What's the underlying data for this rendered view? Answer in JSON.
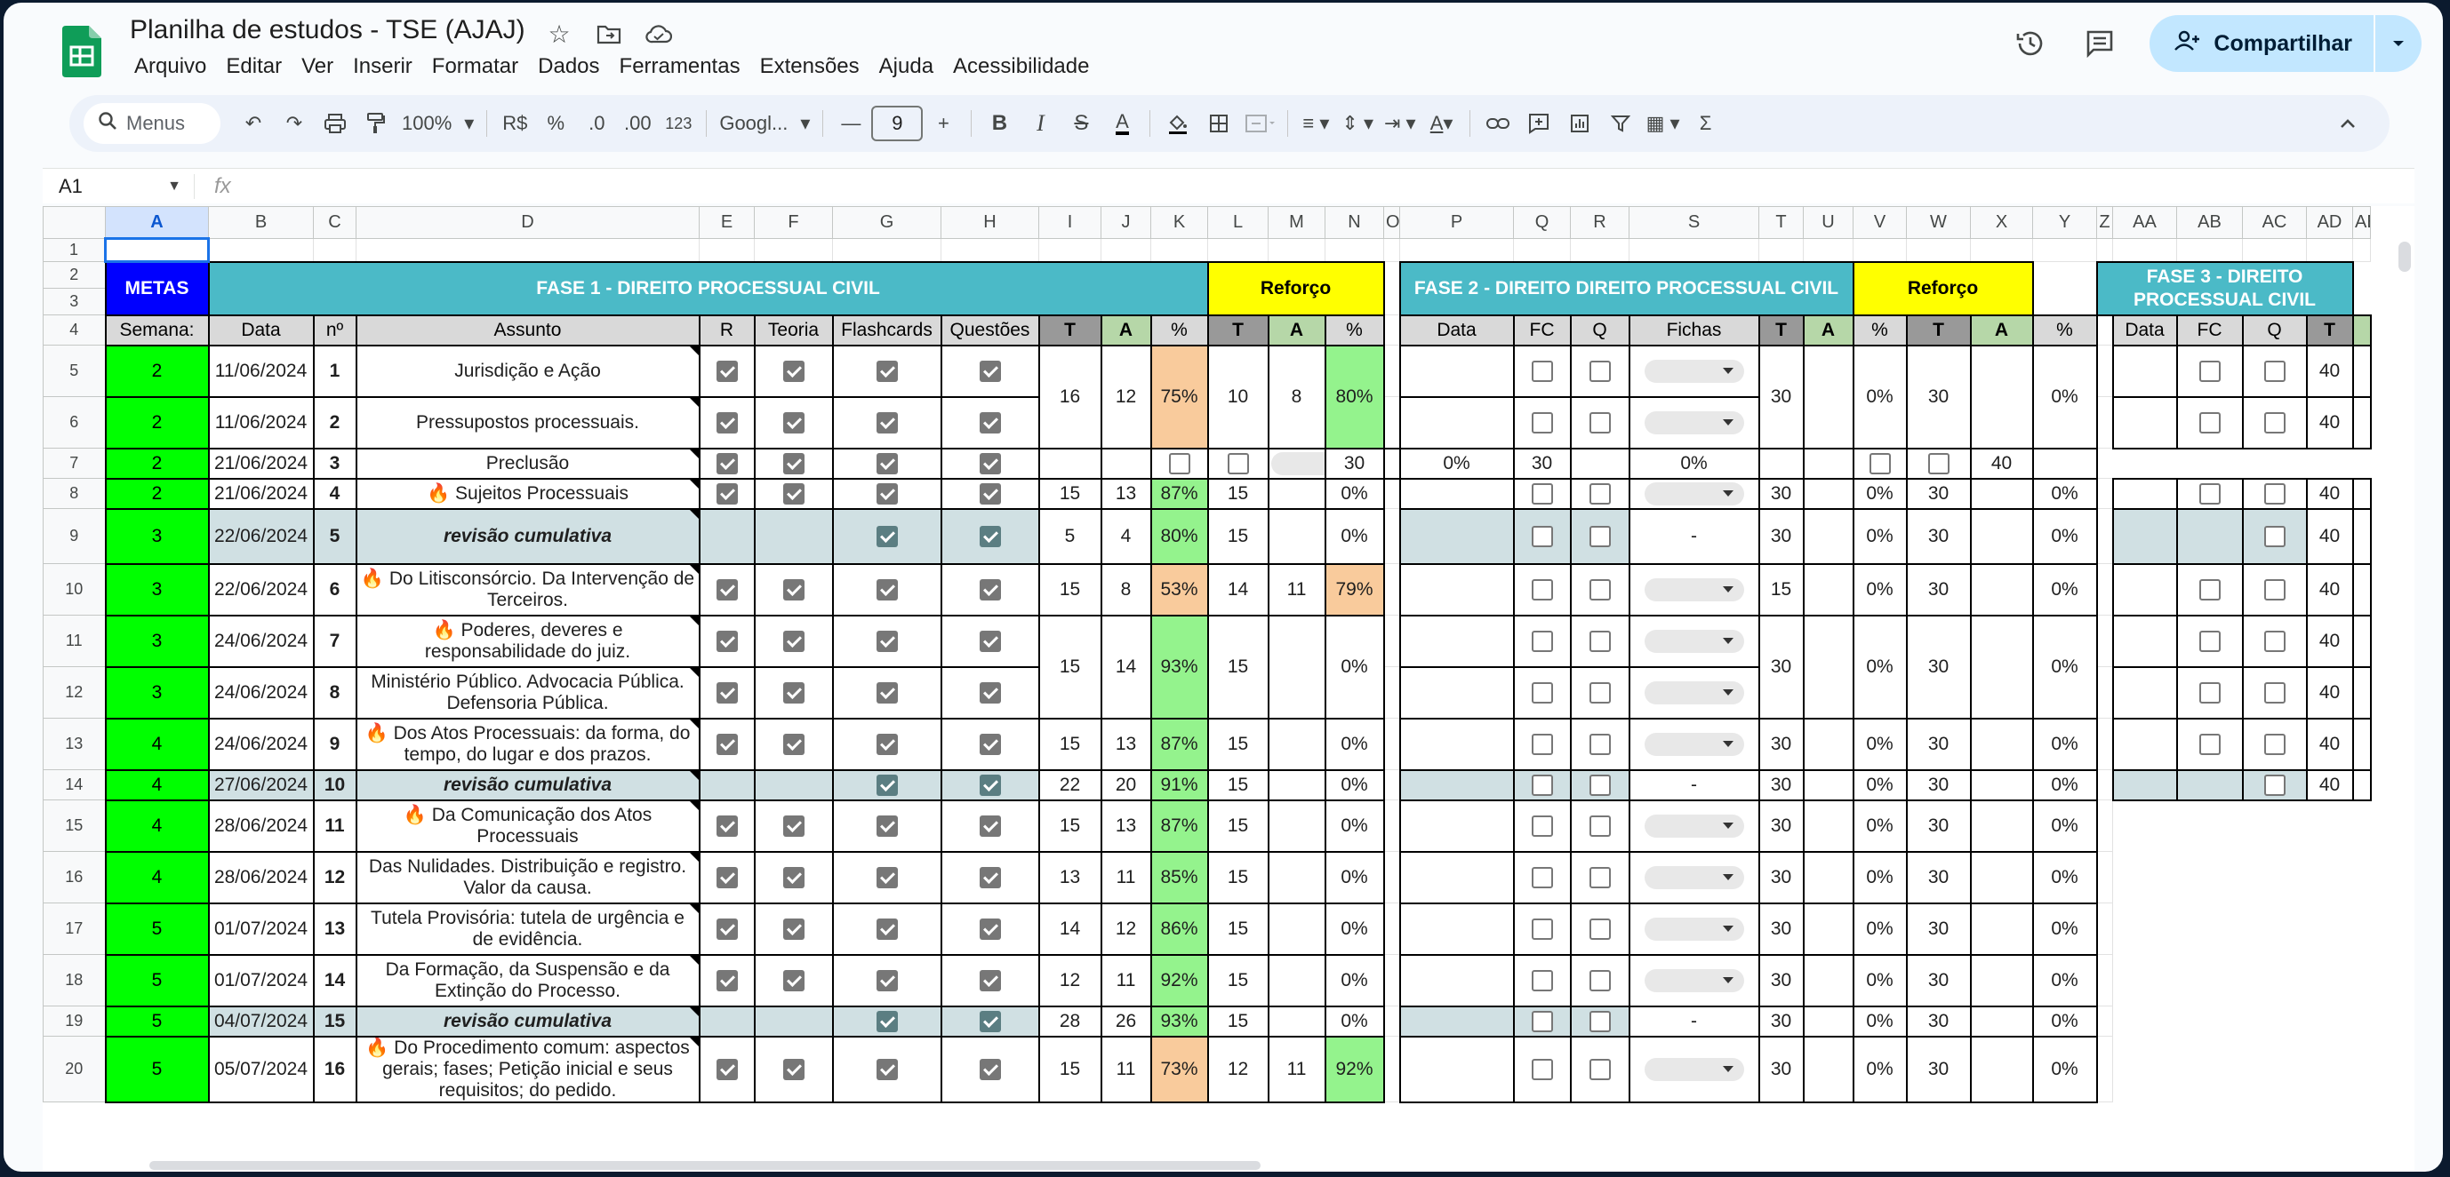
{
  "header": {
    "doc_title": "Planilha de estudos - TSE (AJAJ)",
    "share_label": "Compartilhar",
    "menu": [
      "Arquivo",
      "Editar",
      "Ver",
      "Inserir",
      "Formatar",
      "Dados",
      "Ferramentas",
      "Extensões",
      "Ajuda",
      "Acessibilidade"
    ]
  },
  "toolbar": {
    "search_placeholder": "Menus",
    "zoom": "100%",
    "currency": "R$",
    "percent": "%",
    "dec_decrease": ".0",
    "dec_increase": ".00",
    "format_123": "123",
    "font": "Googl...",
    "font_size": "9",
    "bold": "B",
    "italic": "I"
  },
  "formula_bar": {
    "cell_ref": "A1",
    "fx": "fx",
    "value": ""
  },
  "columns": [
    "A",
    "B",
    "C",
    "D",
    "E",
    "F",
    "G",
    "H",
    "I",
    "J",
    "K",
    "L",
    "M",
    "N",
    "O",
    "P",
    "Q",
    "R",
    "S",
    "T",
    "U",
    "V",
    "W",
    "X",
    "Y",
    "Z",
    "AA",
    "AB",
    "AC",
    "AD",
    "AE"
  ],
  "section_headers": {
    "metas": "METAS",
    "fase1": "FASE 1 - DIREITO PROCESSUAL CIVIL",
    "reforco1": "Reforço",
    "fase2": "FASE 2 - DIREITO DIREITO PROCESSUAL CIVIL",
    "reforco2": "Reforço",
    "fase3": "FASE 3 - DIREITO PROCESSUAL CIVIL"
  },
  "sub_headers": {
    "semana": "Semana:",
    "data": "Data",
    "n": "nº",
    "assunto": "Assunto",
    "r": "R",
    "teoria": "Teoria",
    "flashcards": "Flashcards",
    "questoes": "Questões",
    "t": "T",
    "a": "A",
    "pct": "%",
    "f2_data": "Data",
    "fc": "FC",
    "q": "Q",
    "fichas": "Fichas",
    "f3_data": "Data",
    "f3_fc": "FC",
    "f3_q": "Q",
    "f3_t": "T"
  },
  "rows": [
    {
      "row": "5",
      "semana": "2",
      "data": "11/06/2024",
      "n": "1",
      "assunto": "Jurisdição e Ação",
      "flag": false,
      "rev": false
    },
    {
      "row": "6",
      "semana": "2",
      "data": "11/06/2024",
      "n": "2",
      "assunto": "Pressupostos processuais.",
      "flag": false,
      "rev": false
    },
    {
      "row": "7",
      "semana": "2",
      "data": "21/06/2024",
      "n": "3",
      "assunto": "Preclusão",
      "flag": false,
      "rev": false
    },
    {
      "row": "8",
      "semana": "2",
      "data": "21/06/2024",
      "n": "4",
      "assunto": "Sujeitos Processuais",
      "flag": true,
      "rev": false
    },
    {
      "row": "9",
      "semana": "3",
      "data": "22/06/2024",
      "n": "5",
      "assunto": "revisão cumulativa",
      "flag": false,
      "rev": true
    },
    {
      "row": "10",
      "semana": "3",
      "data": "22/06/2024",
      "n": "6",
      "assunto": "Do Litisconsórcio. Da Intervenção de Terceiros.",
      "flag": true,
      "rev": false
    },
    {
      "row": "11",
      "semana": "3",
      "data": "24/06/2024",
      "n": "7",
      "assunto": "Poderes, deveres e responsabilidade do juiz.",
      "flag": true,
      "rev": false
    },
    {
      "row": "12",
      "semana": "3",
      "data": "24/06/2024",
      "n": "8",
      "assunto": "Ministério Público. Advocacia Pública. Defensoria Pública.",
      "flag": false,
      "rev": false
    },
    {
      "row": "13",
      "semana": "4",
      "data": "24/06/2024",
      "n": "9",
      "assunto": "Dos Atos Processuais: da forma, do tempo, do lugar e dos prazos.",
      "flag": true,
      "rev": false
    },
    {
      "row": "14",
      "semana": "4",
      "data": "27/06/2024",
      "n": "10",
      "assunto": "revisão cumulativa",
      "flag": false,
      "rev": true
    },
    {
      "row": "15",
      "semana": "4",
      "data": "28/06/2024",
      "n": "11",
      "assunto": "Da Comunicação dos Atos Processuais",
      "flag": true,
      "rev": false
    },
    {
      "row": "16",
      "semana": "4",
      "data": "28/06/2024",
      "n": "12",
      "assunto": "Das Nulidades. Distribuição e registro. Valor da causa.",
      "flag": false,
      "rev": false
    },
    {
      "row": "17",
      "semana": "5",
      "data": "01/07/2024",
      "n": "13",
      "assunto": "Tutela Provisória: tutela de urgência e de evidência.",
      "flag": false,
      "rev": false
    },
    {
      "row": "18",
      "semana": "5",
      "data": "01/07/2024",
      "n": "14",
      "assunto": "Da Formação, da Suspensão e da Extinção do Processo.",
      "flag": false,
      "rev": false
    },
    {
      "row": "19",
      "semana": "5",
      "data": "04/07/2024",
      "n": "15",
      "assunto": "revisão cumulativa",
      "flag": false,
      "rev": true
    },
    {
      "row": "20",
      "semana": "5",
      "data": "05/07/2024",
      "n": "16",
      "assunto": "Do Procedimento comum: aspectos gerais; fases; Petição inicial e seus requisitos; do pedido.",
      "flag": true,
      "rev": false
    }
  ],
  "fase1_scores": [
    {
      "t": "16",
      "a": "12",
      "pct": "75%",
      "color": "orange",
      "rt": "10",
      "ra": "8",
      "rpct": "80%",
      "rcolor": "green"
    },
    {
      "t": "15",
      "a": "13",
      "pct": "87%",
      "color": "green",
      "rt": "15",
      "ra": "",
      "rpct": "0%",
      "rcolor": ""
    },
    {
      "t": "5",
      "a": "4",
      "pct": "80%",
      "color": "green",
      "rt": "15",
      "ra": "",
      "rpct": "0%",
      "rcolor": ""
    },
    {
      "t": "15",
      "a": "8",
      "pct": "53%",
      "color": "orange",
      "rt": "14",
      "ra": "11",
      "rpct": "79%",
      "rcolor": "orange"
    },
    {
      "t": "15",
      "a": "14",
      "pct": "93%",
      "color": "green",
      "rt": "15",
      "ra": "",
      "rpct": "0%",
      "rcolor": ""
    },
    {
      "t": "15",
      "a": "13",
      "pct": "87%",
      "color": "green",
      "rt": "15",
      "ra": "",
      "rpct": "0%",
      "rcolor": ""
    },
    {
      "t": "22",
      "a": "20",
      "pct": "91%",
      "color": "green",
      "rt": "15",
      "ra": "",
      "rpct": "0%",
      "rcolor": ""
    },
    {
      "t": "15",
      "a": "13",
      "pct": "87%",
      "color": "green",
      "rt": "15",
      "ra": "",
      "rpct": "0%",
      "rcolor": ""
    },
    {
      "t": "13",
      "a": "11",
      "pct": "85%",
      "color": "green",
      "rt": "15",
      "ra": "",
      "rpct": "0%",
      "rcolor": ""
    },
    {
      "t": "14",
      "a": "12",
      "pct": "86%",
      "color": "green",
      "rt": "15",
      "ra": "",
      "rpct": "0%",
      "rcolor": ""
    },
    {
      "t": "12",
      "a": "11",
      "pct": "92%",
      "color": "green",
      "rt": "15",
      "ra": "",
      "rpct": "0%",
      "rcolor": ""
    },
    {
      "t": "28",
      "a": "26",
      "pct": "93%",
      "color": "green",
      "rt": "15",
      "ra": "",
      "rpct": "0%",
      "rcolor": ""
    },
    {
      "t": "15",
      "a": "11",
      "pct": "73%",
      "color": "orange",
      "rt": "12",
      "ra": "11",
      "rpct": "92%",
      "rcolor": "green"
    }
  ],
  "fase2_values": {
    "t30": "30",
    "t15": "15",
    "pct0": "0%",
    "dash": "-",
    "f3_t": "40"
  },
  "colors": {
    "metas_green": "#00ff00",
    "metas_blue": "#0000ff",
    "fase_teal": "#4bbac7",
    "reforco_yellow": "#ffff00",
    "pct_green": "#94f38d",
    "pct_orange": "#f9cb9c",
    "share_bg": "#c2e7ff",
    "revisao_bg": "#d0e0e3"
  }
}
